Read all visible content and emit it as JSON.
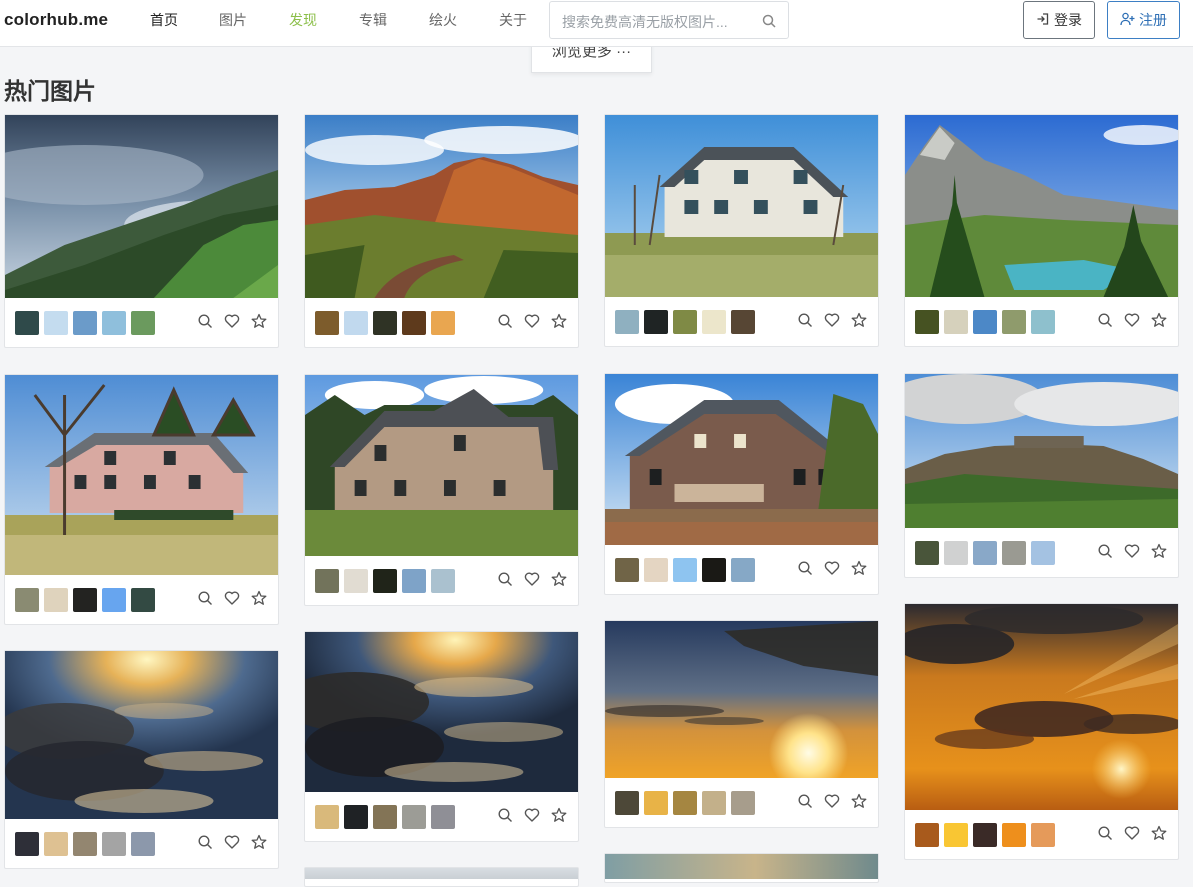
{
  "header": {
    "logo": "colorhub.me",
    "nav": [
      "首页",
      "图片",
      "发现",
      "专辑",
      "绘火",
      "关于"
    ],
    "search_placeholder": "搜索免费高清无版权图片...",
    "login": "登录",
    "register": "注册",
    "more_button": "浏览更多 ···"
  },
  "page_title": "热门图片",
  "icons": [
    "search-icon",
    "heart-icon",
    "star-icon",
    "login-icon",
    "user-plus-icon"
  ],
  "photos": [
    {
      "name": "misty-forest",
      "swatches": [
        "#2f4a4a",
        "#c4dcef",
        "#6b9bc9",
        "#8fbfdc",
        "#6b9a5e"
      ]
    },
    {
      "name": "canyon-road",
      "swatches": [
        "#7d5c2c",
        "#c1d9ee",
        "#2f3325",
        "#5e3a1c",
        "#e9a650"
      ]
    },
    {
      "name": "white-house",
      "swatches": [
        "#8fb0c0",
        "#1f2424",
        "#7f8a45",
        "#ece6cb",
        "#574634"
      ]
    },
    {
      "name": "mountain-lake",
      "swatches": [
        "#465222",
        "#d6d1bc",
        "#4c88c7",
        "#8f9b6c",
        "#8ec0cd"
      ]
    },
    {
      "name": "pink-brick-house",
      "swatches": [
        "#8a8b72",
        "#dfd3bd",
        "#232321",
        "#67a5ef",
        "#334a43"
      ]
    },
    {
      "name": "brick-house-lawn",
      "swatches": [
        "#72735b",
        "#e1dcd2",
        "#202419",
        "#7ea3c8",
        "#aac1cf"
      ]
    },
    {
      "name": "brick-house-porch",
      "swatches": [
        "#706447",
        "#e4d5c2",
        "#8ec4f0",
        "#1a1915",
        "#86a8c6"
      ]
    },
    {
      "name": "castle-hill",
      "swatches": [
        "#49553a",
        "#d0d1d1",
        "#89a8c8",
        "#9a9a92",
        "#a4c2e2"
      ]
    },
    {
      "name": "sun-clouds-reflect",
      "swatches": [
        "#2e2f38",
        "#dec192",
        "#938670",
        "#a4a4a4",
        "#8c98ab"
      ]
    },
    {
      "name": "sun-clouds-reflect-2",
      "swatches": [
        "#d9b97b",
        "#1f2225",
        "#837456",
        "#9c9c96",
        "#8f8f96"
      ]
    },
    {
      "name": "sunset-horizon",
      "swatches": [
        "#4d4838",
        "#e8b347",
        "#a58641",
        "#c3b08a",
        "#a79d8c"
      ]
    },
    {
      "name": "orange-sky-rays",
      "swatches": [
        "#a85a1c",
        "#f9c633",
        "#3a2a27",
        "#ee8f1c",
        "#e59a5a"
      ]
    }
  ]
}
